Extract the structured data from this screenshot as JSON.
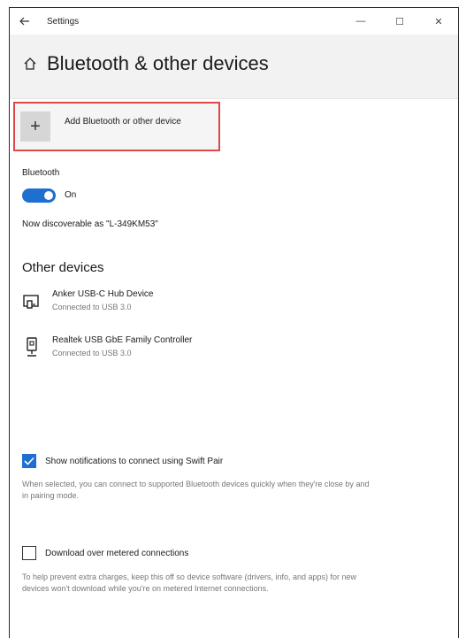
{
  "window": {
    "title": "Settings",
    "back_icon": "arrow-left-icon",
    "minimize_glyph": "—",
    "maximize_glyph": "☐",
    "close_glyph": "✕"
  },
  "page": {
    "title": "Bluetooth & other devices",
    "home_icon": "home-icon"
  },
  "add_device": {
    "glyph": "+",
    "label": "Add Bluetooth or other device",
    "highlight_color": "#e0474c"
  },
  "bluetooth": {
    "heading": "Bluetooth",
    "toggle_state": "On",
    "toggle_on": true,
    "discoverable_text": "Now discoverable as \"L-349KM53\""
  },
  "other_devices": {
    "title": "Other devices",
    "items": [
      {
        "name": "Anker USB-C Hub Device",
        "status": "Connected to USB 3.0",
        "icon": "hub-device-icon"
      },
      {
        "name": "Realtek USB GbE Family Controller",
        "status": "Connected to USB 3.0",
        "icon": "network-adapter-icon"
      }
    ]
  },
  "swift_pair": {
    "checked": true,
    "label": "Show notifications to connect using Swift Pair",
    "description": "When selected, you can connect to supported Bluetooth devices quickly when they're close by and in pairing mode."
  },
  "metered": {
    "checked": false,
    "label": "Download over metered connections",
    "description": "To help prevent extra charges, keep this off so device software (drivers, info, and apps) for new devices won't download while you're on metered Internet connections."
  },
  "colors": {
    "accent": "#1f6fd0",
    "secondary_text": "#777777",
    "header_band": "#f2f2f2"
  }
}
